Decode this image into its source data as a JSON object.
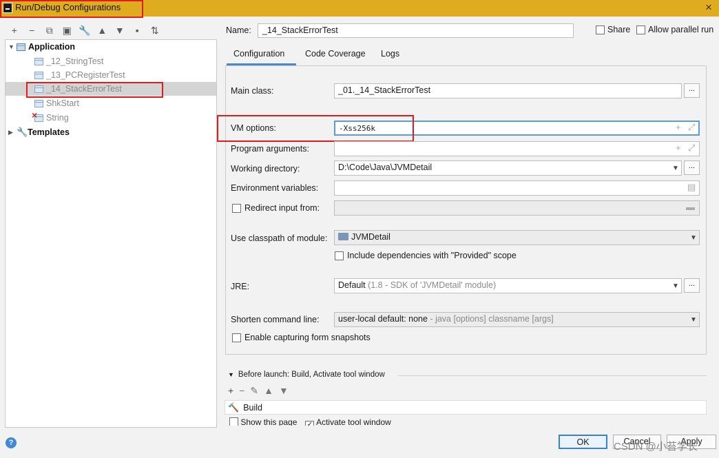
{
  "window": {
    "title": "Run/Debug Configurations",
    "close_icon": "×"
  },
  "toolbar": {
    "icons": [
      {
        "name": "add-icon",
        "glyph": "+"
      },
      {
        "name": "remove-icon",
        "glyph": "−"
      },
      {
        "name": "copy-icon",
        "glyph": "⧉"
      },
      {
        "name": "save-icon",
        "glyph": "▣"
      },
      {
        "name": "wrench-icon",
        "glyph": "🔧"
      },
      {
        "name": "move-up-icon",
        "glyph": "▲"
      },
      {
        "name": "move-down-icon",
        "glyph": "▼"
      },
      {
        "name": "new-folder-icon",
        "glyph": "▪"
      },
      {
        "name": "sort-icon",
        "glyph": "⇅"
      }
    ]
  },
  "tree": {
    "application": "Application",
    "items": [
      "_12_StringTest",
      "_13_PCRegisterTest",
      "_14_StackErrorTest",
      "ShkStart",
      "String"
    ],
    "templates": "Templates"
  },
  "name": {
    "label": "Name:",
    "value": "_14_StackErrorTest"
  },
  "share": {
    "label": "Share",
    "checked": false
  },
  "parallel": {
    "label": "Allow parallel run",
    "checked": false
  },
  "tabs": [
    "Configuration",
    "Code Coverage",
    "Logs"
  ],
  "config": {
    "main_class": {
      "label": "Main class:",
      "value": "_01._14_StackErrorTest"
    },
    "vm_options": {
      "label": "VM options:",
      "value": "-Xss256k"
    },
    "program_args": {
      "label": "Program arguments:",
      "value": ""
    },
    "working_dir": {
      "label": "Working directory:",
      "value": "D:\\Code\\Java\\JVMDetail"
    },
    "env_vars": {
      "label": "Environment variables:",
      "value": ""
    },
    "redirect": {
      "label": "Redirect input from:",
      "value": ""
    },
    "classpath": {
      "label": "Use classpath of module:",
      "value": "JVMDetail"
    },
    "include_deps": {
      "label": "Include dependencies with \"Provided\" scope",
      "checked": false
    },
    "jre": {
      "label": "JRE:",
      "value": "Default",
      "sub": "(1.8 - SDK of 'JVMDetail' module)"
    },
    "shorten": {
      "label": "Shorten command line:",
      "value": "user-local default: none",
      "sub": "- java [options] classname [args]"
    },
    "snapshots": {
      "label": "Enable capturing form snapshots",
      "checked": false
    }
  },
  "before_launch": {
    "title": "Before launch: Build, Activate tool window",
    "task": "Build",
    "show_page": "Show this page",
    "activate": "Activate tool window"
  },
  "buttons": {
    "ok": "OK",
    "cancel": "Cancel",
    "apply": "Apply"
  },
  "help_icon": "?",
  "watermark": "CSDN @小苔学长"
}
